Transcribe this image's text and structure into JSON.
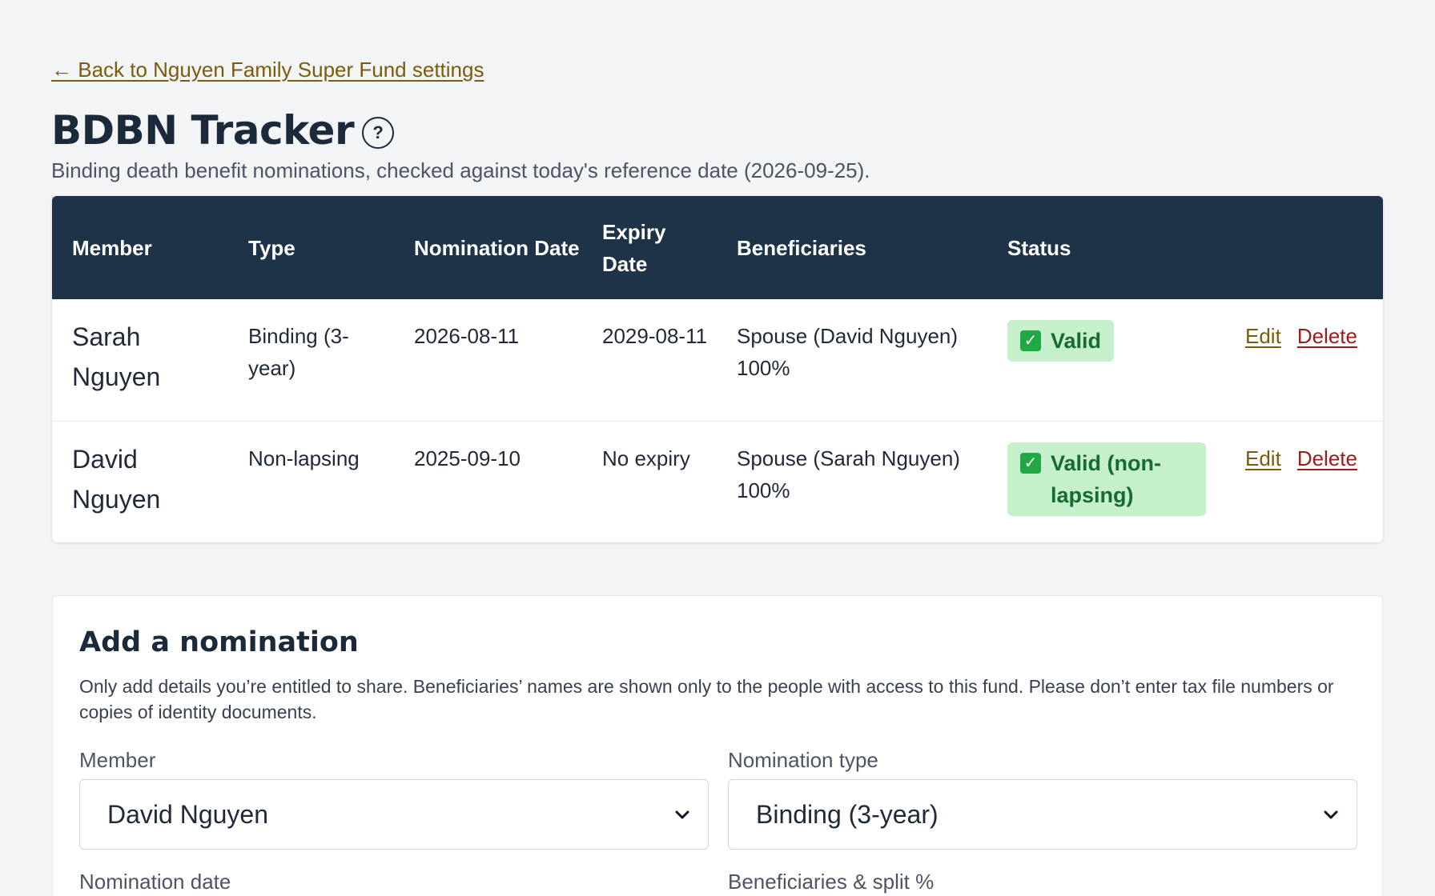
{
  "back_link": "← Back to Nguyen Family Super Fund settings",
  "title": "BDBN Tracker",
  "help_icon": "?",
  "subtitle": "Binding death benefit nominations, checked against today's reference date (2026-09-25).",
  "table": {
    "headers": [
      "Member",
      "Type",
      "Nomination Date",
      "Expiry Date",
      "Beneficiaries",
      "Status"
    ],
    "rows": [
      {
        "member": "Sarah Nguyen",
        "type": "Binding (3-year)",
        "nomination_date": "2026-08-11",
        "expiry_date": "2029-08-11",
        "beneficiaries": "Spouse (David Nguyen) 100%",
        "status": "Valid",
        "edit": "Edit",
        "delete": "Delete"
      },
      {
        "member": "David Nguyen",
        "type": "Non-lapsing",
        "nomination_date": "2025-09-10",
        "expiry_date": "No expiry",
        "beneficiaries": "Spouse (Sarah Nguyen) 100%",
        "status": "Valid (non-lapsing)",
        "edit": "Edit",
        "delete": "Delete"
      }
    ]
  },
  "form": {
    "title": "Add a nomination",
    "note": "Only add details you’re entitled to share. Beneficiaries’ names are shown only to the people with access to this fund. Please don’t enter tax file numbers or copies of identity documents.",
    "member_label": "Member",
    "member_value": "David Nguyen",
    "type_label": "Nomination type",
    "type_value": "Binding (3-year)",
    "date_label": "Nomination date",
    "beneficiaries_label": "Beneficiaries & split %"
  },
  "colors": {
    "header_bg": "#1e3348",
    "link": "#7a5c0a",
    "delete": "#9b1c1c",
    "badge_bg": "#c6efcc",
    "badge_text": "#146c2e"
  }
}
